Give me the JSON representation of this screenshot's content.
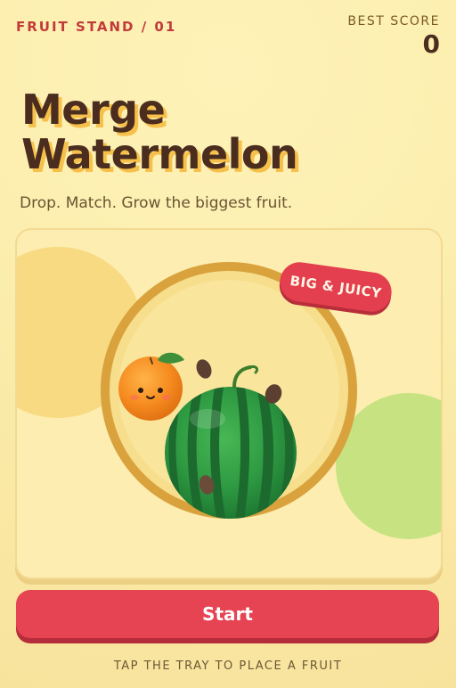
{
  "header": {
    "label": "FRUIT STAND / 01",
    "best_score_label": "BEST SCORE",
    "best_score_value": "0"
  },
  "title": {
    "line1": "Merge",
    "line2": "Watermelon"
  },
  "subtitle": "Drop. Match. Grow the biggest fruit.",
  "badge": "BIG & JUICY",
  "start_button": "Start",
  "hint": "TAP THE TRAY TO PLACE A FRUIT",
  "colors": {
    "accent": "#E64353",
    "title_text": "#4A2D1E",
    "title_shadow": "#F6C04A",
    "label_red": "#C23B3B",
    "background": "#FBEAA6"
  }
}
